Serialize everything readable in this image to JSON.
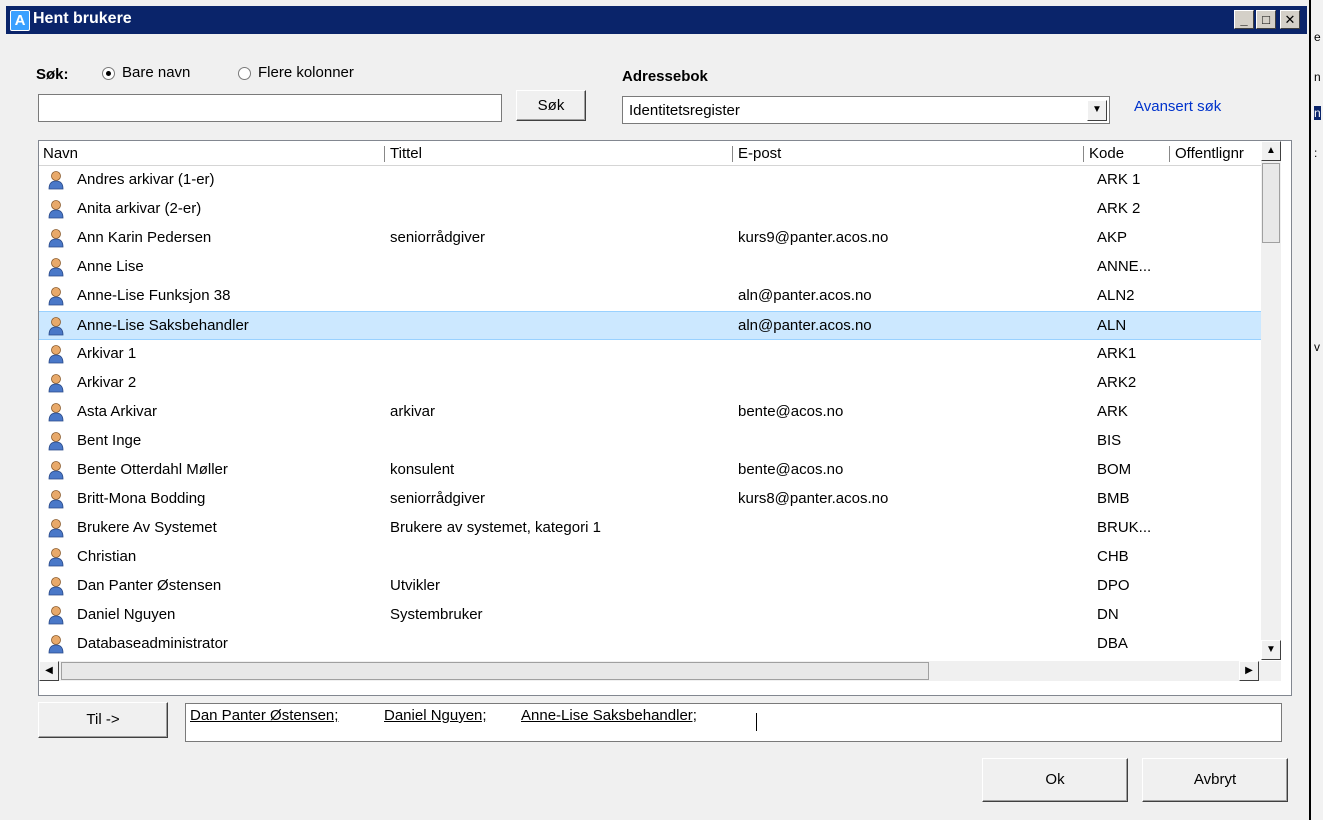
{
  "window": {
    "title": "Hent brukere",
    "logo_letter": "A",
    "min_glyph": "_",
    "max_glyph": "□",
    "close_glyph": "✕"
  },
  "search": {
    "label": "Søk:",
    "options": [
      "Bare navn",
      "Flere kolonner"
    ],
    "selected_option": "Bare navn",
    "value": "",
    "button_label": "Søk"
  },
  "addressbook": {
    "label": "Adressebok",
    "selected": "Identitetsregister",
    "advanced_link": "Avansert søk"
  },
  "list": {
    "columns": [
      "Navn",
      "Tittel",
      "E-post",
      "Kode",
      "Offentlignr"
    ],
    "rows": [
      {
        "name": "Andres arkivar (1-er)",
        "title": "",
        "email": "",
        "code": "ARK 1"
      },
      {
        "name": "Anita arkivar (2-er)",
        "title": "",
        "email": "",
        "code": "ARK 2"
      },
      {
        "name": "Ann Karin Pedersen",
        "title": "seniorrådgiver",
        "email": "kurs9@panter.acos.no",
        "code": "AKP"
      },
      {
        "name": "Anne Lise",
        "title": "",
        "email": "",
        "code": "ANNE..."
      },
      {
        "name": "Anne-Lise Funksjon 38",
        "title": "",
        "email": "aln@panter.acos.no",
        "code": "ALN2"
      },
      {
        "name": "Anne-Lise Saksbehandler",
        "title": "",
        "email": "aln@panter.acos.no",
        "code": "ALN",
        "selected": true
      },
      {
        "name": "Arkivar 1",
        "title": "",
        "email": "",
        "code": "ARK1"
      },
      {
        "name": "Arkivar 2",
        "title": "",
        "email": "",
        "code": "ARK2"
      },
      {
        "name": "Asta Arkivar",
        "title": "arkivar",
        "email": "bente@acos.no",
        "code": "ARK"
      },
      {
        "name": "Bent Inge",
        "title": "",
        "email": "",
        "code": "BIS"
      },
      {
        "name": "Bente Otterdahl Møller",
        "title": "konsulent",
        "email": "bente@acos.no",
        "code": "BOM"
      },
      {
        "name": "Britt-Mona Bodding",
        "title": "seniorrådgiver",
        "email": "kurs8@panter.acos.no",
        "code": "BMB"
      },
      {
        "name": "Brukere Av Systemet",
        "title": "Brukere av systemet, kategori 1",
        "email": "",
        "code": "BRUK..."
      },
      {
        "name": "Christian",
        "title": "",
        "email": "",
        "code": "CHB"
      },
      {
        "name": "Dan Panter Østensen",
        "title": "Utvikler",
        "email": "",
        "code": "DPO"
      },
      {
        "name": "Daniel Nguyen",
        "title": "Systembruker",
        "email": "",
        "code": "DN"
      },
      {
        "name": "Databaseadministrator",
        "title": "",
        "email": "",
        "code": "DBA"
      }
    ]
  },
  "recipients": {
    "to_button": "Til ->",
    "items": [
      "Dan Panter Østensen;",
      "Daniel Nguyen;",
      "Anne-Lise Saksbehandler;"
    ]
  },
  "footer": {
    "ok_label": "Ok",
    "cancel_label": "Avbryt"
  },
  "colors": {
    "titlebar": "#0a246a",
    "selection": "#cce8ff",
    "link": "#0033cc"
  }
}
